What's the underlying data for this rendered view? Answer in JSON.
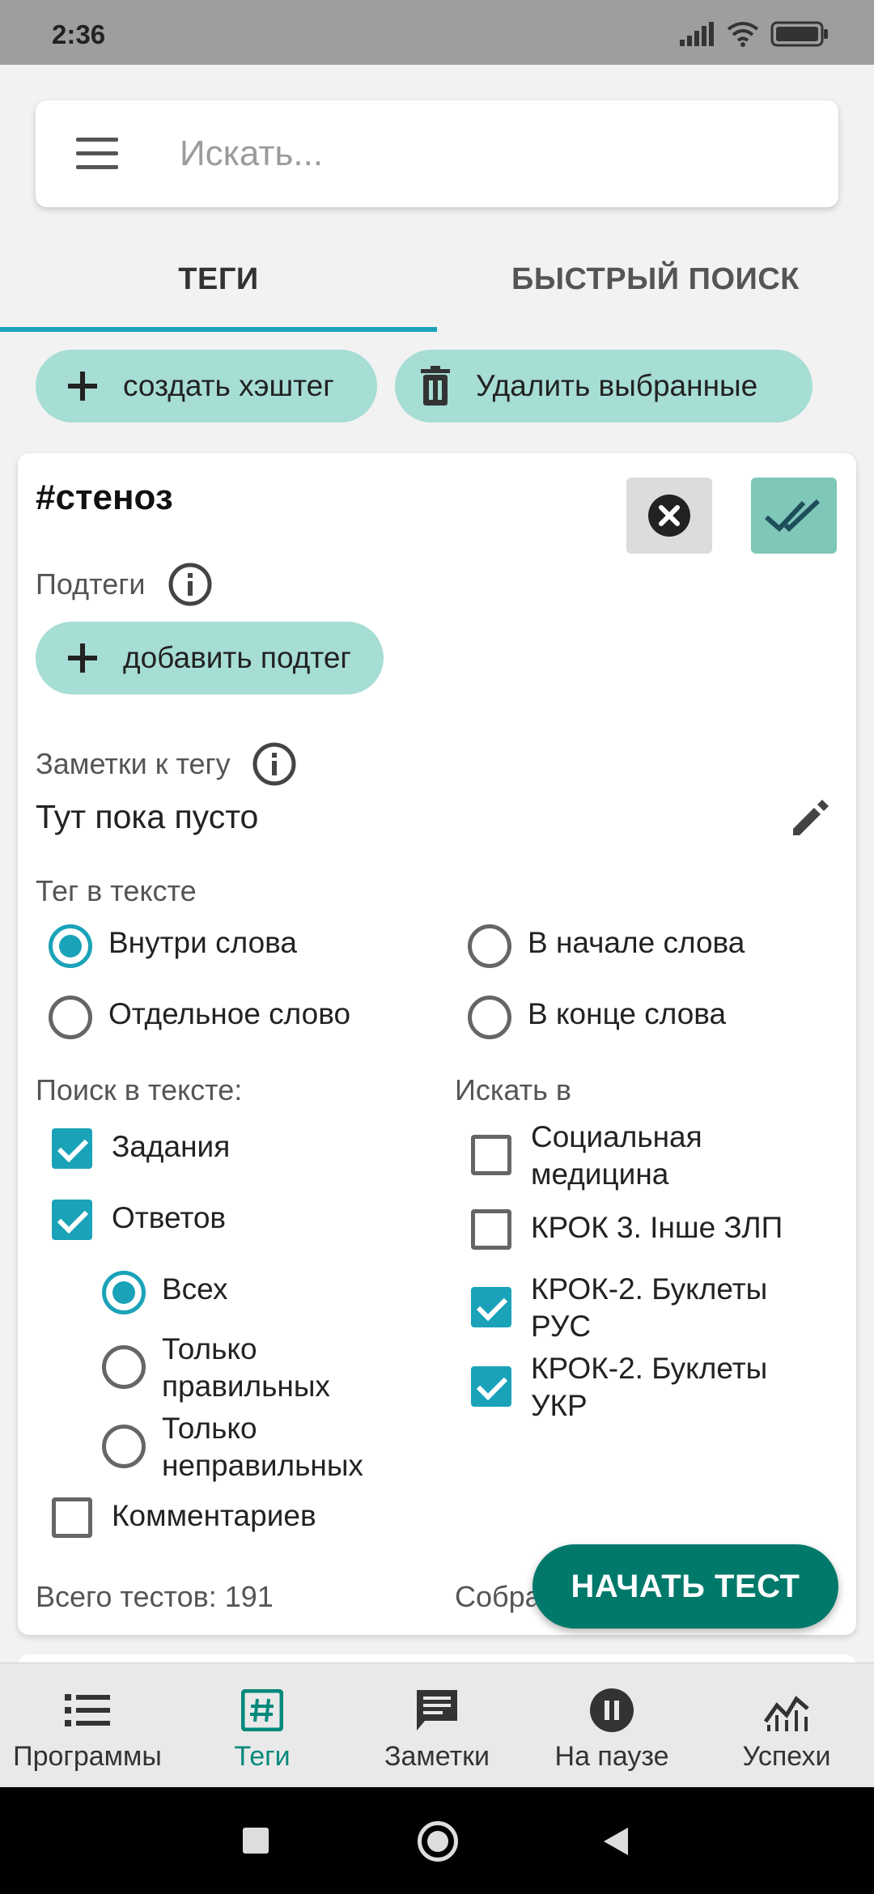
{
  "status_bar": {
    "time": "2:36"
  },
  "search": {
    "placeholder": "Искать..."
  },
  "tabs": [
    {
      "label": "ТЕГИ",
      "active": true
    },
    {
      "label": "БЫСТРЫЙ ПОИСК",
      "active": false
    }
  ],
  "actions": {
    "create_hashtag": "создать хэштег",
    "delete_selected": "Удалить выбранные"
  },
  "tag_card": {
    "title": "#стеноз",
    "subtags_label": "Подтеги",
    "add_subtag": "добавить подтег",
    "notes_label": "Заметки к тегу",
    "notes_text": "Тут пока пусто",
    "tag_in_text_label": "Тег в тексте",
    "tag_position_options": [
      {
        "label": "Внутри слова",
        "selected": true
      },
      {
        "label": "В начале слова",
        "selected": false
      },
      {
        "label": "Отдельное слово",
        "selected": false
      },
      {
        "label": "В конце слова",
        "selected": false
      }
    ],
    "search_in_text_label": "Поиск в тексте:",
    "search_in_text": {
      "tasks": {
        "label": "Задания",
        "checked": true
      },
      "answers": {
        "label": "Ответов",
        "checked": true
      },
      "answer_filter": [
        {
          "label": "Всех",
          "selected": true
        },
        {
          "label": "Только правильных",
          "selected": false
        },
        {
          "label": "Только неправильных",
          "selected": false
        }
      ],
      "comments": {
        "label": "Комментариев",
        "checked": false
      }
    },
    "search_in_label": "Искать в",
    "search_in_sources": [
      {
        "label": "Социальная медицина",
        "checked": false
      },
      {
        "label": "КРОК 3. Інше ЗЛП",
        "checked": false
      },
      {
        "label": "КРОК-2. Буклеты РУС",
        "checked": true
      },
      {
        "label": "КРОК-2. Буклеты УКР",
        "checked": true
      }
    ],
    "total_tests": "Всего тестов: 191",
    "collected_partial": "Собра",
    "start_test": "НАЧАТЬ ТЕСТ"
  },
  "bottom_nav": [
    {
      "label": "Программы",
      "icon": "list-icon",
      "active": false
    },
    {
      "label": "Теги",
      "icon": "hashtag-icon",
      "active": true
    },
    {
      "label": "Заметки",
      "icon": "note-icon",
      "active": false
    },
    {
      "label": "На паузе",
      "icon": "pause-icon",
      "active": false
    },
    {
      "label": "Успехи",
      "icon": "chart-icon",
      "active": false
    }
  ],
  "colors": {
    "accent": "#1aa3b8",
    "chip": "#a6ddd4",
    "fab": "#00796b",
    "nav_active": "#00897b"
  }
}
